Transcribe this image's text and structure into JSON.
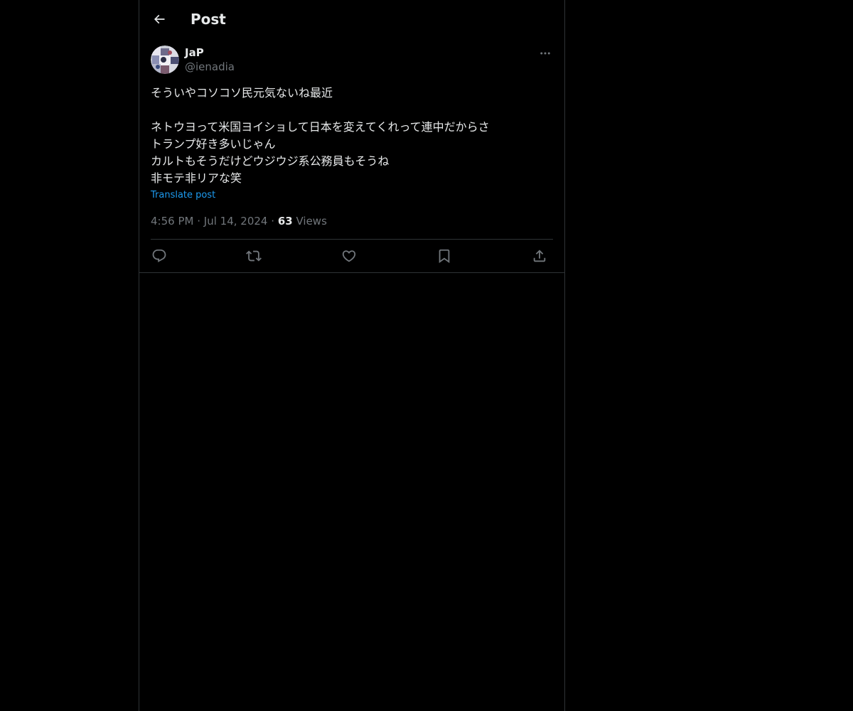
{
  "header": {
    "title": "Post",
    "back_icon": "arrow-left-icon"
  },
  "post": {
    "author": {
      "display_name": "JaP",
      "handle": "@ienadia"
    },
    "text_lines": [
      "そういやコソコソ民元気ないね最近",
      "",
      "ネトウヨって米国ヨイショして日本を変えてくれって連中だからさ",
      "トランプ好き多いじゃん",
      "カルトもそうだけどウジウジ系公務員もそうね",
      "非モテ非リアな笑"
    ],
    "translate_label": "Translate post",
    "time": "4:56 PM",
    "separator": "·",
    "date": "Jul 14, 2024",
    "views_count": "63",
    "views_label": "Views"
  },
  "actions": [
    {
      "name": "reply",
      "icon": "reply-icon"
    },
    {
      "name": "repost",
      "icon": "repost-icon"
    },
    {
      "name": "like",
      "icon": "heart-icon"
    },
    {
      "name": "bookmark",
      "icon": "bookmark-icon"
    },
    {
      "name": "share",
      "icon": "share-icon"
    }
  ],
  "colors": {
    "background": "#000000",
    "text": "#e7e9ea",
    "muted": "#71767b",
    "link": "#1d9bf0",
    "border": "#2f3336"
  }
}
